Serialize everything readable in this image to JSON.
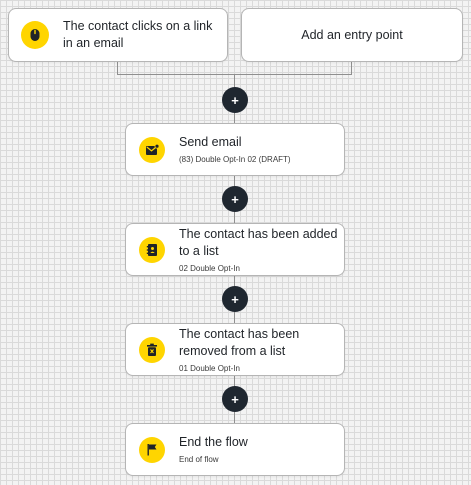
{
  "entry_points": [
    {
      "label": "The contact clicks on a link in an email",
      "icon": "mouse-icon"
    },
    {
      "label": "Add an entry point"
    }
  ],
  "add_step_symbol": "+",
  "steps": [
    {
      "title": "Send email",
      "subtitle": "(83) Double Opt-In 02 (DRAFT)",
      "icon": "email-icon"
    },
    {
      "title": "The contact has been added to a list",
      "subtitle": "02 Double Opt-In",
      "icon": "contact-list-icon"
    },
    {
      "title": "The contact has been removed from a list",
      "subtitle": "01 Double Opt-In",
      "icon": "trash-icon"
    },
    {
      "title": "End the flow",
      "subtitle": "End of flow",
      "icon": "flag-icon"
    }
  ],
  "colors": {
    "accent_yellow": "#ffd500",
    "plus_button": "#1f2730",
    "connector": "#8f8f8f",
    "card_border": "#b5b5b5"
  }
}
